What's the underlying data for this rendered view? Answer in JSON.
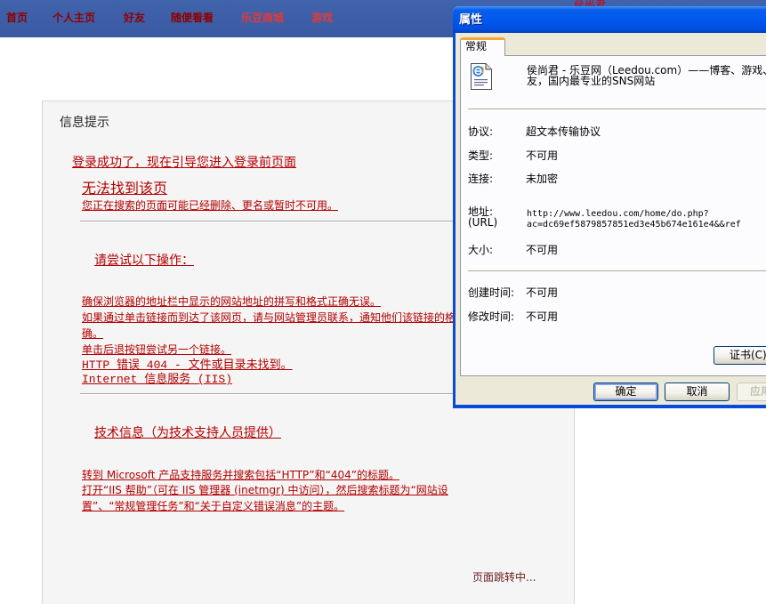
{
  "theme": {
    "nav_bg": "#3a5aa2",
    "nav_text": "#8e0000",
    "nav_highlight": "#e03a3a",
    "link_color": "#b40000",
    "dialog_face": "#ece9d8",
    "titlebar_blue": "#0058ee"
  },
  "nav": {
    "items": [
      "首页",
      "个人主页",
      "好友",
      "随便看看",
      "乐豆商城",
      "游戏"
    ],
    "user": "侯尚君"
  },
  "notice": {
    "title": "信息提示",
    "login_msg": "登录成功了，现在引导您进入登录前页面",
    "error_title": "无法找到该页",
    "error_desc": "您正在搜索的页面可能已经删除、更名或暂时不可用。",
    "try_heading": "请尝试以下操作：",
    "try_lines": [
      "确保浏览器的地址栏中显示的网站地址的拼写和格式正确无误。",
      "如果通过单击链接而到达了该网页，请与网站管理员联系，通知他们该链接的格",
      "确。",
      "单击后退按钮尝试另一个链接。"
    ],
    "http_error": "HTTP 错误 404 - 文件或目录未找到。",
    "iis": "Internet 信息服务 (IIS)",
    "tech_heading": "技术信息（为技术支持人员提供）",
    "tech_lines": [
      "转到 Microsoft 产品支持服务并搜索包括“HTTP”和“404”的标题。",
      "打开“IIS 帮助”（可在 IIS 管理器 (inetmgr) 中访问），然后搜索标题为“网站设",
      "置”、“常规管理任务”和“关于自定义错误消息”的主题。"
    ],
    "redirect": "页面跳转中..."
  },
  "dialog": {
    "title": "属性",
    "tab": "常规",
    "icon": "ie-document-icon",
    "page_title_lines": [
      "侯尚君 - 乐豆网（Leedou.com）——博客、游戏、",
      "友，国内最专业的SNS网站"
    ],
    "fields": {
      "protocol": {
        "label": "协议:",
        "value": "超文本传输协议"
      },
      "type": {
        "label": "类型:",
        "value": "不可用"
      },
      "connection": {
        "label": "连接:",
        "value": "未加密"
      },
      "address": {
        "label": "地址:",
        "label_sub": "(URL)",
        "value_lines": [
          "http://www.leedou.com/home/do.php?",
          "ac=dc69ef5879857851ed3e45b674e161e4&&ref"
        ]
      },
      "size": {
        "label": "大小:",
        "value": "不可用"
      },
      "created": {
        "label": "创建时间:",
        "value": "不可用"
      },
      "modified": {
        "label": "修改时间:",
        "value": "不可用"
      }
    },
    "cert_button": "证书(C)",
    "buttons": {
      "ok": "确定",
      "cancel": "取消",
      "apply": "应用"
    }
  }
}
